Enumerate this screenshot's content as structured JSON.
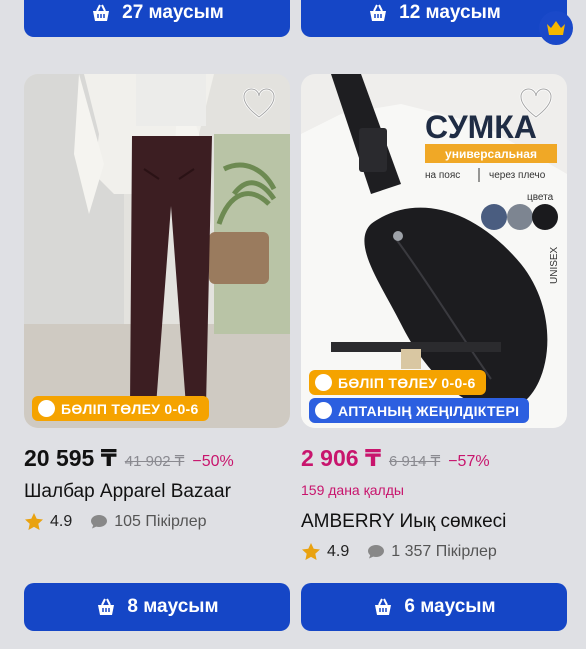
{
  "top_buttons": [
    {
      "label": "27 маусым"
    },
    {
      "label": "12 маусым"
    }
  ],
  "products": [
    {
      "badges": [
        {
          "label": "БӨЛІП ТӨЛЕУ 0-0-6",
          "color": "#f5a300"
        }
      ],
      "price": "20 595 ₸",
      "old_price": "41 902 ₸",
      "discount": "−50%",
      "name": "Шалбар Apparel Bazaar",
      "rating": "4.9",
      "reviews": "105 Пікірлер",
      "button": "8 маусым"
    },
    {
      "image_text": {
        "title": "СУМКА",
        "subtitle": "универсальная",
        "left_caption": "на пояс",
        "right_caption": "через плечо",
        "colors_label": "цвета",
        "side_label": "UNISEX",
        "swatches": [
          "#4a5d80",
          "#7d8591",
          "#1a1a1d"
        ]
      },
      "badges": [
        {
          "label": "БӨЛІП ТӨЛЕУ 0-0-6",
          "color": "#f5a300"
        },
        {
          "label": "АПТАНЫҢ ЖЕҢІЛДІКТЕРІ",
          "color": "#2c5fe0"
        }
      ],
      "price": "2 906 ₸",
      "old_price": "6 914 ₸",
      "discount": "−57%",
      "stock_left": "159 дана қалды",
      "name": "AMBERRY Иық сөмкесі",
      "rating": "4.9",
      "reviews": "1 357 Пікірлер",
      "button": "6 маусым"
    }
  ],
  "icons": {
    "button": "shopping-basket-icon",
    "favorite": "heart-outline-icon",
    "rating": "star-icon",
    "reviews": "chat-bubble-icon",
    "installment": "pie-icon",
    "weekly": "flame-icon",
    "floating": "crown-icon"
  },
  "colors": {
    "accent": "#1546c6",
    "installment_badge": "#f5a300",
    "weekly_badge": "#2c5fe0",
    "price_discount": "#c8156d"
  }
}
